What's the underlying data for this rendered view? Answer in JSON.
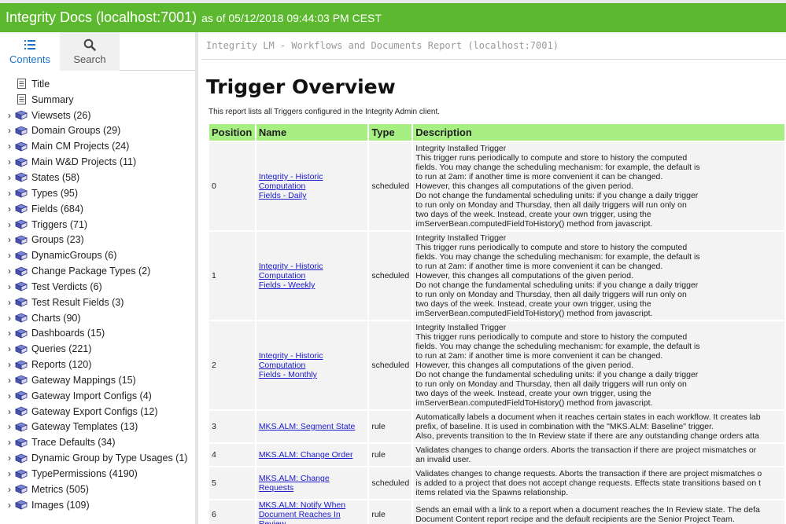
{
  "header": {
    "app_title": "Integrity Docs (localhost:7001)",
    "as_of": "as of 05/12/2018 09:44:03 PM CEST"
  },
  "colors": {
    "topbar": "#5cb82e",
    "table_header": "#a7ef83",
    "link": "#1a1acc",
    "tab_active": "#1f73c4"
  },
  "tabs": [
    {
      "label": "Contents",
      "icon": "list-icon"
    },
    {
      "label": "Search",
      "icon": "search-icon"
    }
  ],
  "tree": [
    {
      "label": "Title",
      "icon": "page-icon",
      "expandable": false
    },
    {
      "label": "Summary",
      "icon": "page-icon",
      "expandable": false
    },
    {
      "label": "Viewsets (26)",
      "icon": "book-icon",
      "expandable": true
    },
    {
      "label": "Domain Groups (29)",
      "icon": "book-icon",
      "expandable": true
    },
    {
      "label": "Main CM Projects (24)",
      "icon": "book-icon",
      "expandable": true
    },
    {
      "label": "Main W&D Projects (11)",
      "icon": "book-icon",
      "expandable": true
    },
    {
      "label": "States (58)",
      "icon": "book-icon",
      "expandable": true
    },
    {
      "label": "Types (95)",
      "icon": "book-icon",
      "expandable": true
    },
    {
      "label": "Fields (684)",
      "icon": "book-icon",
      "expandable": true
    },
    {
      "label": "Triggers (71)",
      "icon": "book-icon",
      "expandable": true
    },
    {
      "label": "Groups (23)",
      "icon": "book-icon",
      "expandable": true
    },
    {
      "label": "DynamicGroups (6)",
      "icon": "book-icon",
      "expandable": true
    },
    {
      "label": "Change Package Types (2)",
      "icon": "book-icon",
      "expandable": true
    },
    {
      "label": "Test Verdicts (6)",
      "icon": "book-icon",
      "expandable": true
    },
    {
      "label": "Test Result Fields (3)",
      "icon": "book-icon",
      "expandable": true
    },
    {
      "label": "Charts (90)",
      "icon": "book-icon",
      "expandable": true
    },
    {
      "label": "Dashboards (15)",
      "icon": "book-icon",
      "expandable": true
    },
    {
      "label": "Queries (221)",
      "icon": "book-icon",
      "expandable": true
    },
    {
      "label": "Reports (120)",
      "icon": "book-icon",
      "expandable": true
    },
    {
      "label": "Gateway Mappings (15)",
      "icon": "book-icon",
      "expandable": true
    },
    {
      "label": "Gateway Import Configs (4)",
      "icon": "book-icon",
      "expandable": true
    },
    {
      "label": "Gateway Export Configs (12)",
      "icon": "book-icon",
      "expandable": true
    },
    {
      "label": "Gateway Templates (13)",
      "icon": "book-icon",
      "expandable": true
    },
    {
      "label": "Trace Defaults (34)",
      "icon": "book-icon",
      "expandable": true
    },
    {
      "label": "Dynamic Group by Type Usages (1)",
      "icon": "book-icon",
      "expandable": true
    },
    {
      "label": "TypePermissions (4190)",
      "icon": "book-icon",
      "expandable": true
    },
    {
      "label": "Metrics (505)",
      "icon": "book-icon",
      "expandable": true
    },
    {
      "label": "Images (109)",
      "icon": "book-icon",
      "expandable": true
    }
  ],
  "main": {
    "report_header": "Integrity LM - Workflows and Documents Report (localhost:7001)",
    "title": "Trigger Overview",
    "intro": "This report lists all Triggers configured in the Integrity Admin client.",
    "columns": [
      "Position",
      "Name",
      "Type",
      "Description"
    ],
    "rows": [
      {
        "position": "0",
        "name_lines": [
          "Integrity - Historic Computation",
          "Fields - Daily"
        ],
        "type": "scheduled",
        "desc_lines": [
          "Integrity Installed Trigger",
          "This trigger runs periodically to compute and store to history the computed",
          "fields. You may change the scheduling mechanism: for example, the default is",
          "to run at 2am: if another time is more convenient it can be changed.",
          "However, this changes all computations of the given period.",
          "Do not change the fundamental scheduling units: if you change a daily trigger",
          "to run only on Monday and Thursday, then all daily triggers will run only on",
          "two days of the week. Instead, create your own trigger, using the",
          "imServerBean.computedFieldToHistory() method from javascript."
        ]
      },
      {
        "position": "1",
        "name_lines": [
          "Integrity - Historic Computation",
          "Fields - Weekly"
        ],
        "type": "scheduled",
        "desc_lines": [
          "Integrity Installed Trigger",
          "This trigger runs periodically to compute and store to history the computed",
          "fields. You may change the scheduling mechanism: for example, the default is",
          "to run at 2am: if another time is more convenient it can be changed.",
          "However, this changes all computations of the given period.",
          "Do not change the fundamental scheduling units: if you change a daily trigger",
          "to run only on Monday and Thursday, then all daily triggers will run only on",
          "two days of the week. Instead, create your own trigger, using the",
          "imServerBean.computedFieldToHistory() method from javascript."
        ]
      },
      {
        "position": "2",
        "name_lines": [
          "Integrity - Historic Computation",
          "Fields - Monthly"
        ],
        "type": "scheduled",
        "desc_lines": [
          "Integrity Installed Trigger",
          "This trigger runs periodically to compute and store to history the computed",
          "fields. You may change the scheduling mechanism: for example, the default is",
          "to run at 2am: if another time is more convenient it can be changed.",
          "However, this changes all computations of the given period.",
          "Do not change the fundamental scheduling units: if you change a daily trigger",
          "to run only on Monday and Thursday, then all daily triggers will run only on",
          "two days of the week. Instead, create your own trigger, using the",
          "imServerBean.computedFieldToHistory() method from javascript."
        ]
      },
      {
        "position": "3",
        "name_lines": [
          "MKS.ALM: Segment State"
        ],
        "type": "rule",
        "desc_lines": [
          "Automatically labels a document when it reaches certain states in each workflow. It creates lab",
          "prefix, of baseline. It is used in combination with the \"MKS.ALM: Baseline\" trigger.",
          "Also, prevents transition to the In Review state if there are any outstanding change orders atta"
        ]
      },
      {
        "position": "4",
        "name_lines": [
          "MKS.ALM: Change Order"
        ],
        "type": "rule",
        "desc_lines": [
          "Validates changes to change orders. Aborts the transaction if there are project mismatches or",
          "an invalid user."
        ]
      },
      {
        "position": "5",
        "name_lines": [
          "MKS.ALM: Change Requests"
        ],
        "type": "scheduled",
        "desc_lines": [
          "Validates changes to change requests. Aborts the transaction if there are project mismatches o",
          "is added to a project that does not accept change requests. Effects state transitions based on t",
          "items related via the Spawns relationship."
        ]
      },
      {
        "position": "6",
        "name_lines": [
          "MKS.ALM: Notify When",
          "Document Reaches In Review"
        ],
        "type": "rule",
        "desc_lines": [
          "Sends an email with a link to a report when a document reaches the In Review state. The defa",
          "Document Content report recipe and the default recipients are the Senior Project Team."
        ]
      }
    ]
  }
}
